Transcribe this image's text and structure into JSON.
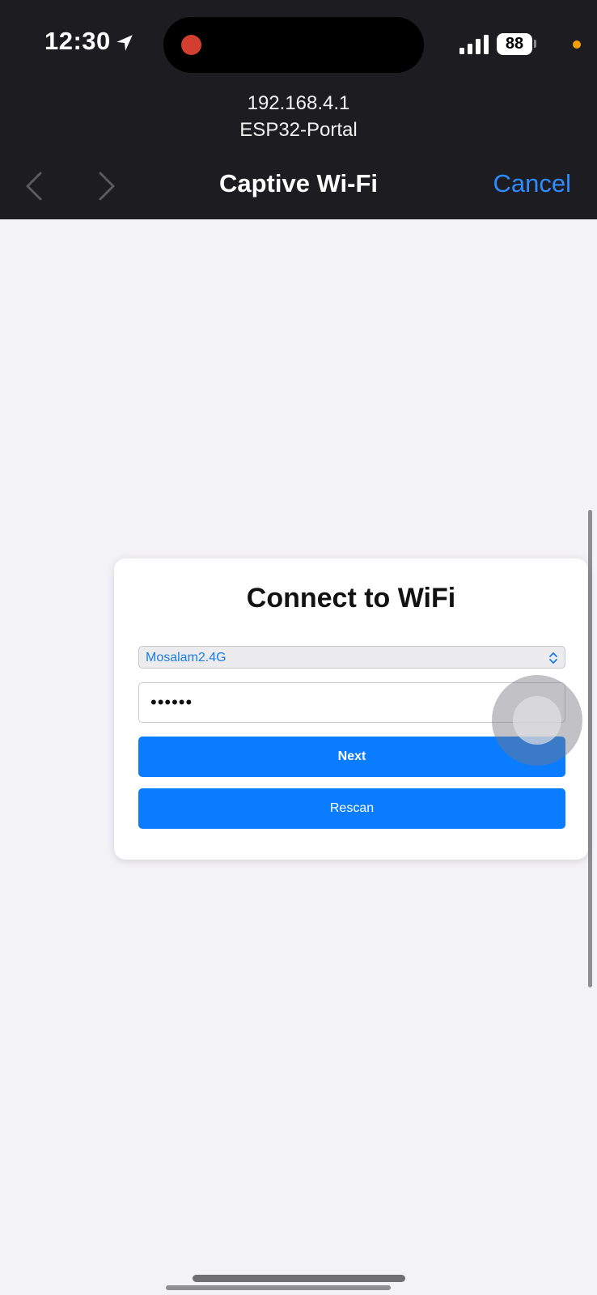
{
  "status_bar": {
    "time": "12:30",
    "battery": "88",
    "icons": [
      "location-arrow-icon",
      "cellular-signal-icon",
      "battery-icon"
    ]
  },
  "browser": {
    "url": "192.168.4.1",
    "site_name": "ESP32-Portal",
    "title": "Captive Wi-Fi",
    "cancel_label": "Cancel"
  },
  "form": {
    "heading": "Connect to WiFi",
    "selected_network": "Mosalam2.4G",
    "password_mask": "••••••",
    "next_label": "Next",
    "rescan_label": "Rescan"
  },
  "colors": {
    "accent": "#0a7cff",
    "cancel": "#2f8cff",
    "header_bg": "#1d1c21",
    "page_bg": "#f3f2f7"
  }
}
